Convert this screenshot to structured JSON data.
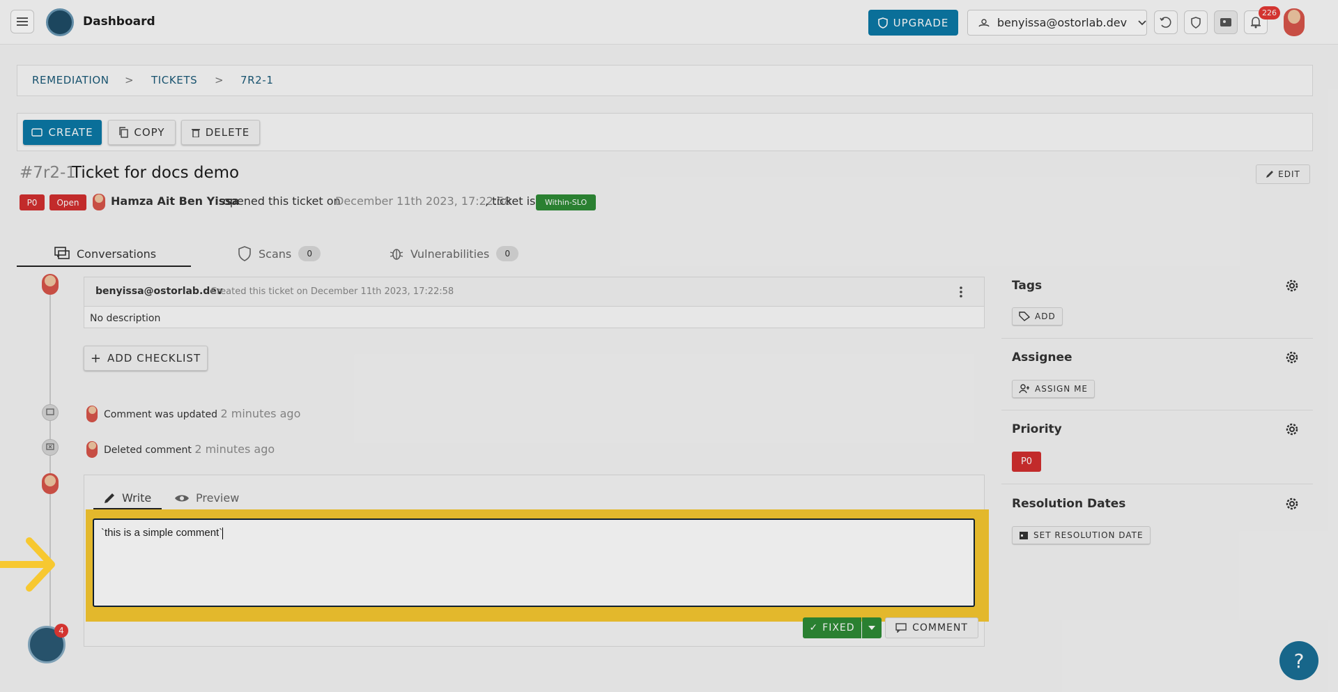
{
  "header": {
    "title": "Dashboard",
    "upgrade_label": "UPGRADE",
    "org_email": "benyissa@ostorlab.dev",
    "notification_count": "226"
  },
  "breadcrumb": [
    "REMEDIATION",
    "TICKETS",
    "7R2-1"
  ],
  "breadcrumb_separator": ">",
  "actions": {
    "create": "CREATE",
    "copy": "COPY",
    "delete": "DELETE",
    "edit": "EDIT"
  },
  "ticket": {
    "id": "#7r2-1",
    "title": "Ticket for docs demo",
    "priority_chip": "P0",
    "status_chip": "Open",
    "author": "Hamza Ait Ben Yissa",
    "opened_text": "opened this ticket on",
    "opened_date": "December 11th 2023, 17:22:58",
    "ticket_is_text": ", ticket is",
    "slo_chip": "Within-SLO"
  },
  "tabs": [
    {
      "label": "Conversations",
      "count": null
    },
    {
      "label": "Scans",
      "count": "0"
    },
    {
      "label": "Vulnerabilities",
      "count": "0"
    }
  ],
  "conversation": {
    "card_user": "benyissa@ostorlab.dev",
    "card_meta": "Created this ticket on December 11th 2023, 17:22:58",
    "card_body": "No description",
    "add_checklist": "ADD CHECKLIST",
    "events": [
      {
        "text": "Comment was updated",
        "time": "2 minutes ago"
      },
      {
        "text": "Deleted comment",
        "time": "2 minutes ago"
      }
    ]
  },
  "editor": {
    "write_tab": "Write",
    "preview_tab": "Preview",
    "value": "`this is a simple comment`",
    "fixed_label": "FIXED",
    "comment_label": "COMMENT"
  },
  "sidebar": {
    "tags": {
      "title": "Tags",
      "button": "ADD"
    },
    "assignee": {
      "title": "Assignee",
      "button": "ASSIGN ME"
    },
    "priority": {
      "title": "Priority",
      "value": "P0"
    },
    "resolution": {
      "title": "Resolution Dates",
      "button": "SET RESOLUTION DATE"
    }
  },
  "misc": {
    "help_label": "?",
    "bottom_badge": "4"
  },
  "colors": {
    "primary": "#0b79a6",
    "danger": "#d32f2f",
    "success": "#2e8b36",
    "highlight": "#f7c830"
  }
}
